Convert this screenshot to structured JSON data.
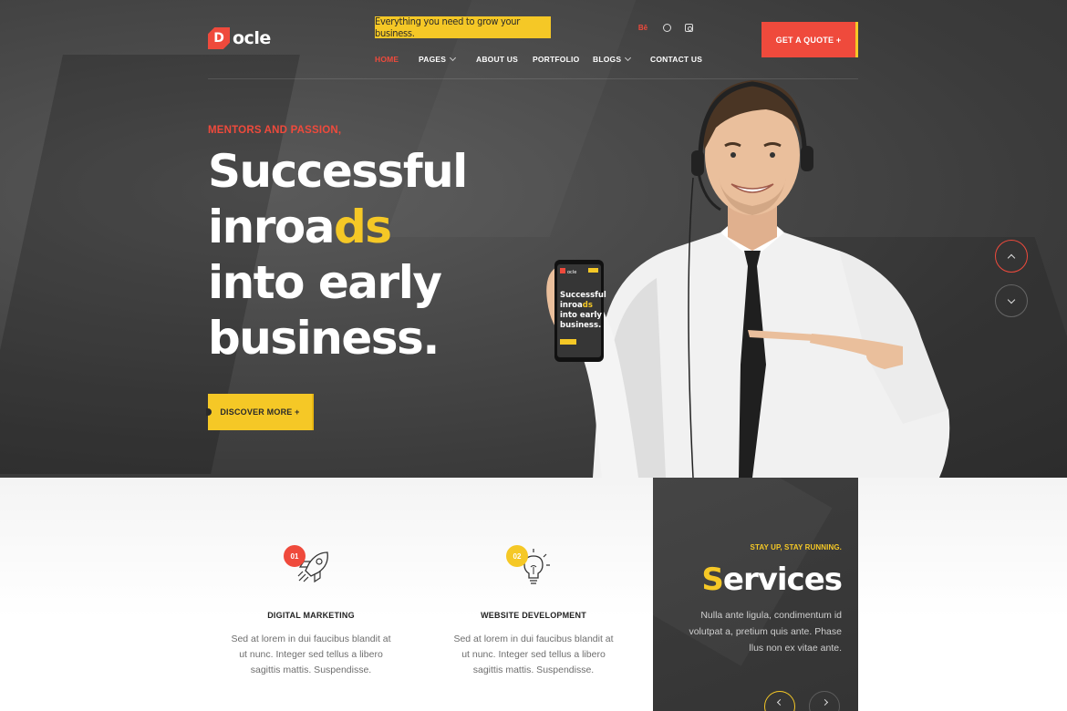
{
  "brand": {
    "logo_letter": "D",
    "logo_text": "ocle"
  },
  "header": {
    "tagline": "Everything you need to grow your business.",
    "social": {
      "behance": "Bē"
    },
    "quote_button": "GET A QUOTE  +",
    "nav": [
      {
        "label": "HOME",
        "active": true
      },
      {
        "label": "PAGES",
        "dropdown": true
      },
      {
        "label": "ABOUT US"
      },
      {
        "label": "PORTFOLIO"
      },
      {
        "label": "BLOGS",
        "dropdown": true
      },
      {
        "label": "CONTACT US"
      }
    ]
  },
  "hero": {
    "kicker": "MENTORS AND PASSION,",
    "headline_line1": "Successful",
    "headline_line2_a": "inroa",
    "headline_line2_b": "ds",
    "headline_line3": "into early",
    "headline_line4": "business.",
    "cta": "DISCOVER MORE +",
    "phone": {
      "logo_text": "ocle",
      "line1": "Successful",
      "line2_a": "inroa",
      "line2_b": "ds",
      "line3": "into early",
      "line4": "business."
    }
  },
  "features": [
    {
      "number": "01",
      "title": "DIGITAL MARKETING",
      "description": "Sed at lorem in dui faucibus blandit at ut nunc. Integer sed tellus a libero sagittis mattis. Suspendisse.",
      "badge_color": "#ef4a3c",
      "icon": "rocket-icon"
    },
    {
      "number": "02",
      "title": "WEBSITE DEVELOPMENT",
      "description": "Sed at lorem in dui faucibus blandit at ut nunc. Integer sed tellus a libero sagittis mattis. Suspendisse.",
      "badge_color": "#f5c826",
      "icon": "lightbulb-icon"
    }
  ],
  "services": {
    "kicker": "STAY UP, STAY RUNNING.",
    "title_first": "S",
    "title_rest": "ervices",
    "description": "Nulla ante ligula, condimentum id volutpat a, pretium quis ante. Phase llus non ex vitae ante."
  },
  "colors": {
    "accent_red": "#ef4a3c",
    "accent_yellow": "#f5c826",
    "hero_dark": "#3b3b3b"
  }
}
